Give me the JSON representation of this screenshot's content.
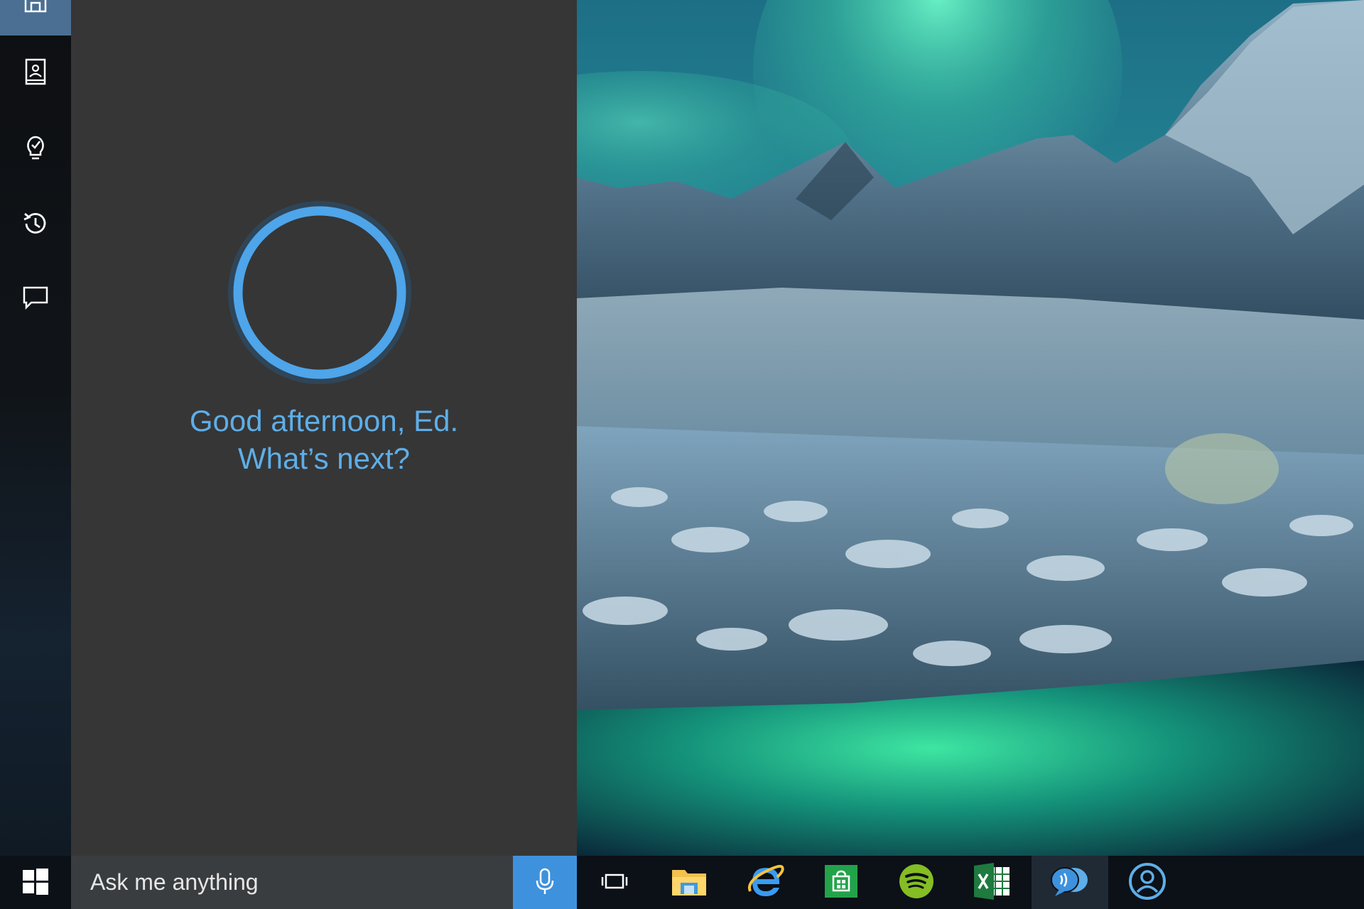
{
  "cortana": {
    "greeting_line1": "Good afternoon, Ed.",
    "greeting_line2": "What’s next?",
    "accent_color": "#5eaee8"
  },
  "sidebar": {
    "items": [
      {
        "name": "home",
        "icon": "home-icon",
        "active": true
      },
      {
        "name": "notebook",
        "icon": "notebook-icon"
      },
      {
        "name": "reminders",
        "icon": "lightbulb-icon"
      },
      {
        "name": "history",
        "icon": "history-icon"
      },
      {
        "name": "feedback",
        "icon": "feedback-icon"
      }
    ]
  },
  "taskbar": {
    "search_placeholder": "Ask me anything",
    "search_icon": "microphone-icon",
    "apps": [
      {
        "name": "task-view",
        "icon": "task-view-icon"
      },
      {
        "name": "file-explorer",
        "icon": "folder-icon"
      },
      {
        "name": "internet-explorer",
        "icon": "internet-explorer-icon"
      },
      {
        "name": "store",
        "icon": "store-icon"
      },
      {
        "name": "spotify",
        "icon": "spotify-icon"
      },
      {
        "name": "excel",
        "icon": "excel-icon"
      },
      {
        "name": "speech",
        "icon": "speech-icon"
      },
      {
        "name": "people",
        "icon": "people-icon"
      }
    ],
    "accent_color": "#3e92dd"
  }
}
